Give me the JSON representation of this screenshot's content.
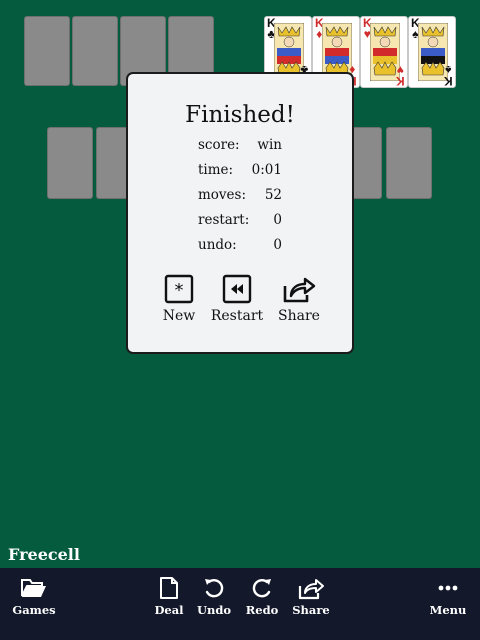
{
  "board": {
    "freecells": 4,
    "foundations": [
      {
        "rank": "K",
        "suit": "♣",
        "color": "black"
      },
      {
        "rank": "K",
        "suit": "♦",
        "color": "red"
      },
      {
        "rank": "K",
        "suit": "♥",
        "color": "red"
      },
      {
        "rank": "K",
        "suit": "♠",
        "color": "black"
      }
    ],
    "tableau_visible_slots": 8
  },
  "dialog": {
    "title": "Finished!",
    "stats": [
      {
        "label": "score:",
        "value": "win"
      },
      {
        "label": "time:",
        "value": "0:01"
      },
      {
        "label": "moves:",
        "value": "52"
      },
      {
        "label": "restart:",
        "value": "0"
      },
      {
        "label": "undo:",
        "value": "0"
      }
    ],
    "actions": [
      {
        "name": "new",
        "label": "New",
        "icon": "asterisk-box-icon"
      },
      {
        "name": "restart",
        "label": "Restart",
        "icon": "rewind-box-icon"
      },
      {
        "name": "share",
        "label": "Share",
        "icon": "share-icon"
      }
    ]
  },
  "app": {
    "title": "Freecell"
  },
  "toolbar": {
    "games": "Games",
    "deal": "Deal",
    "undo": "Undo",
    "redo": "Redo",
    "share": "Share",
    "menu": "Menu"
  },
  "colors": {
    "felt": "#045b3e",
    "toolbar": "#13192b",
    "slot": "#8a8a8a"
  }
}
